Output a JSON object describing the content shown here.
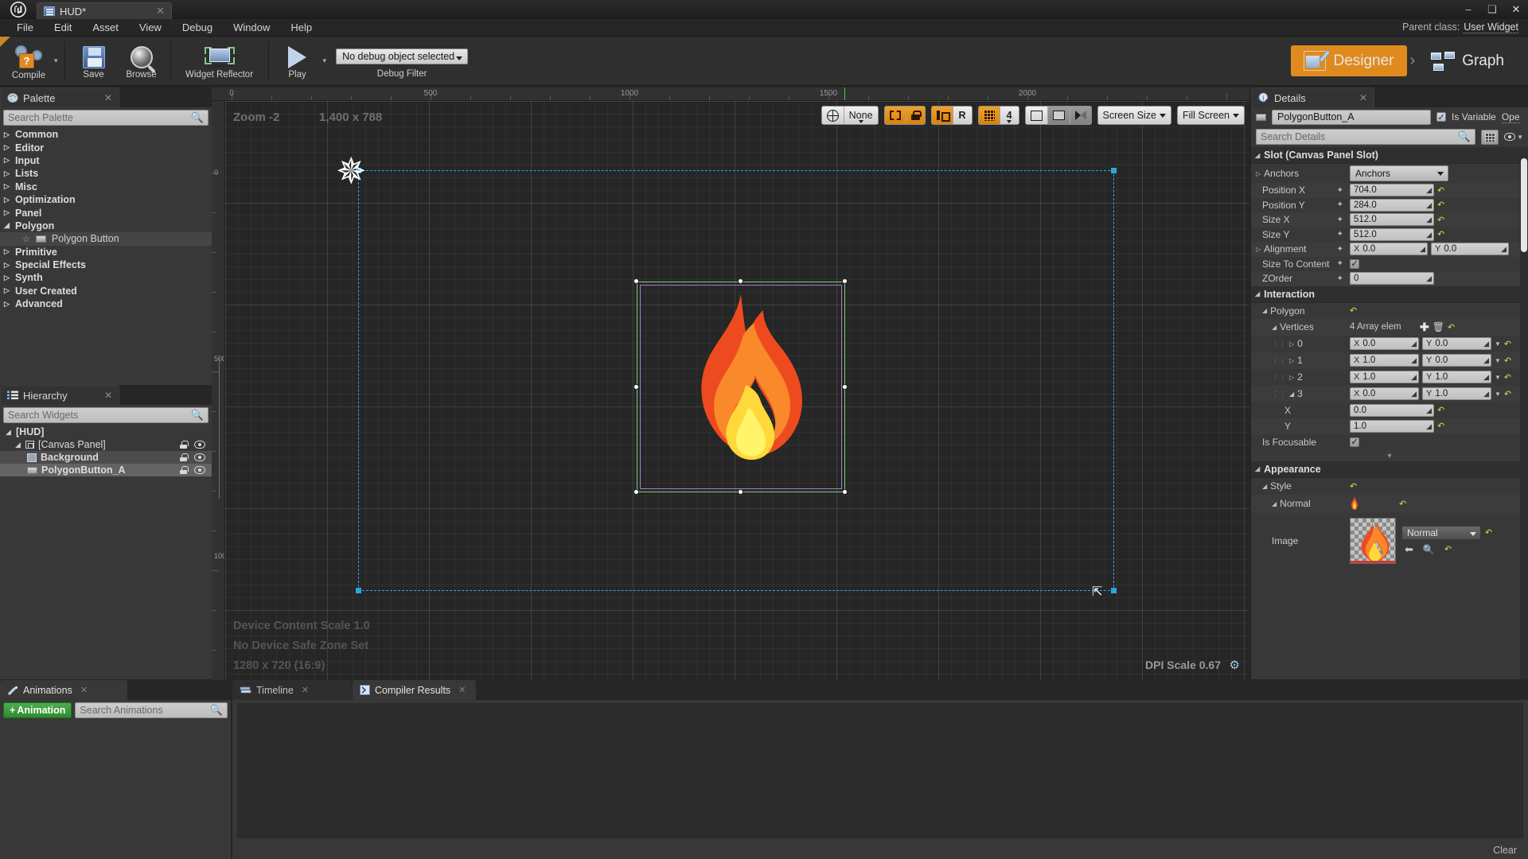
{
  "window": {
    "app_logo": "unreal-logo",
    "tab_title": "HUD*",
    "minimize": "–",
    "maximize": "❑",
    "close": "✕"
  },
  "menubar": {
    "items": [
      "File",
      "Edit",
      "Asset",
      "View",
      "Debug",
      "Window",
      "Help"
    ],
    "parent_class_label": "Parent class:",
    "parent_class_value": "User Widget"
  },
  "toolbar": {
    "compile": "Compile",
    "save": "Save",
    "browse": "Browse",
    "widget_reflector": "Widget Reflector",
    "play": "Play",
    "debug_object": "No debug object selected",
    "debug_filter": "Debug Filter",
    "designer": "Designer",
    "graph": "Graph",
    "mode_separator": "›"
  },
  "palette": {
    "title": "Palette",
    "close": "✕",
    "search_placeholder": "Search Palette",
    "categories": [
      {
        "label": "Common",
        "expanded": false
      },
      {
        "label": "Editor",
        "expanded": false
      },
      {
        "label": "Input",
        "expanded": false
      },
      {
        "label": "Lists",
        "expanded": false
      },
      {
        "label": "Misc",
        "expanded": false
      },
      {
        "label": "Optimization",
        "expanded": false
      },
      {
        "label": "Panel",
        "expanded": false
      },
      {
        "label": "Polygon",
        "expanded": true
      },
      {
        "label": "Primitive",
        "expanded": false
      },
      {
        "label": "Special Effects",
        "expanded": false
      },
      {
        "label": "Synth",
        "expanded": false
      },
      {
        "label": "User Created",
        "expanded": false
      },
      {
        "label": "Advanced",
        "expanded": false
      }
    ],
    "polygon_item": "Polygon Button"
  },
  "hierarchy": {
    "title": "Hierarchy",
    "close": "✕",
    "search_placeholder": "Search Widgets",
    "nodes": [
      {
        "label": "[HUD]",
        "depth": 0,
        "expanded": true,
        "icons": false,
        "selected": "none"
      },
      {
        "label": "[Canvas Panel]",
        "depth": 1,
        "expanded": true,
        "icons": true,
        "selected": "none"
      },
      {
        "label": "Background",
        "depth": 2,
        "expanded": false,
        "icons": true,
        "selected": "soft"
      },
      {
        "label": "PolygonButton_A",
        "depth": 2,
        "expanded": false,
        "icons": true,
        "selected": "strong"
      }
    ]
  },
  "canvas": {
    "zoom_label": "Zoom -2",
    "size_label": "1,400 x 788",
    "device_content_scale": "Device Content Scale 1.0",
    "safe_zone": "No Device Safe Zone Set",
    "resolution": "1280 x 720 (16:9)",
    "dpi_scale": "DPI Scale 0.67",
    "ruler_h_labels": [
      "0",
      "500",
      "1000",
      "1500",
      "2000"
    ],
    "ruler_v_labels": [
      "0",
      "500",
      "1000"
    ],
    "toolbar": {
      "localization": "None",
      "dashed_outline": "dashed-outline-icon",
      "lock": "lock-icon",
      "snap_layout": "snap-layout-icon",
      "snap_rotation": "R",
      "grid_snap": "grid-snap-icon",
      "grid_size": "4",
      "fit_to_content": "fit-icon",
      "image_preview": "image-icon",
      "mirror": "mirror-icon",
      "screen_size": "Screen Size",
      "fill_screen": "Fill Screen"
    }
  },
  "details": {
    "title": "Details",
    "close": "✕",
    "object_name": "PolygonButton_A",
    "is_variable": "Is Variable",
    "open_link": "Ope",
    "search_placeholder": "Search Details",
    "sections": [
      {
        "name": "Slot (Canvas Panel Slot)"
      },
      {
        "name": "Interaction"
      },
      {
        "name": "Appearance"
      }
    ],
    "slot": {
      "header": "Slot (Canvas Panel Slot)",
      "anchors_label": "Anchors",
      "anchors_value": "Anchors",
      "position_x_label": "Position X",
      "position_x": "704.0",
      "position_y_label": "Position Y",
      "position_y": "284.0",
      "size_x_label": "Size X",
      "size_x": "512.0",
      "size_y_label": "Size Y",
      "size_y": "512.0",
      "alignment_label": "Alignment",
      "alignment_x": "0.0",
      "alignment_y": "0.0",
      "size_to_content_label": "Size To Content",
      "size_to_content": false,
      "zorder_label": "ZOrder",
      "zorder": "0"
    },
    "interaction": {
      "header": "Interaction",
      "polygon_label": "Polygon",
      "vertices_label": "Vertices",
      "vertices_count": "4 Array elem",
      "vertices": [
        {
          "index": "0",
          "x": "0.0",
          "y": "0.0",
          "expanded": false
        },
        {
          "index": "1",
          "x": "1.0",
          "y": "0.0",
          "expanded": false
        },
        {
          "index": "2",
          "x": "1.0",
          "y": "1.0",
          "expanded": false
        },
        {
          "index": "3",
          "x": "0.0",
          "y": "1.0",
          "expanded": true
        }
      ],
      "vertex3_x_label": "X",
      "vertex3_x": "0.0",
      "vertex3_y_label": "Y",
      "vertex3_y": "1.0",
      "is_focusable_label": "Is Focusable",
      "is_focusable": true
    },
    "appearance": {
      "header": "Appearance",
      "style_label": "Style",
      "normal_label": "Normal",
      "image_label": "Image",
      "image_value": "Normal"
    },
    "axis_x": "X",
    "axis_y": "Y"
  },
  "bottom": {
    "animations_tab": "Animations",
    "timeline_tab": "Timeline",
    "compiler_results_tab": "Compiler Results",
    "add_animation": "Animation",
    "add_plus": "+",
    "search_animations_placeholder": "Search Animations",
    "clear": "Clear",
    "close": "✕"
  },
  "colors": {
    "accent_orange": "#e08a1e",
    "selection_green": "#74d674",
    "selection_purple": "#b07ad0",
    "canvas_blue": "#2ea6e0",
    "revert_yellow": "#e6d44a",
    "green_button": "#3f9b3f"
  }
}
